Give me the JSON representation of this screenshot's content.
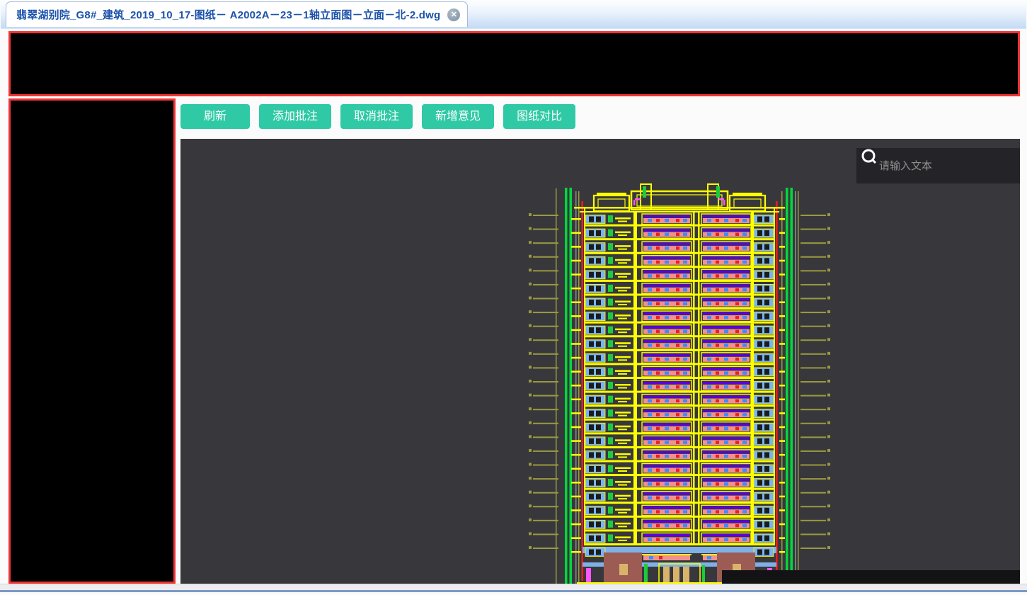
{
  "tab": {
    "title": "翡翠湖别院_G8#_建筑_2019_10_17-图纸－ A2002A－23－1轴立面图－立面－北-2.dwg",
    "close_glyph": "✕"
  },
  "toolbar": {
    "buttons": [
      {
        "label": "刷新"
      },
      {
        "label": "添加批注"
      },
      {
        "label": "取消批注"
      },
      {
        "label": "新增意见"
      },
      {
        "label": "图纸对比"
      }
    ],
    "button_color": "#2fc9a5"
  },
  "search": {
    "placeholder": "请输入文本"
  },
  "panels": {
    "fill": "#000000",
    "border": "#f03434"
  },
  "canvas": {
    "background": "#38383c"
  },
  "drawing": {
    "type": "cad-building-elevation",
    "floors": 24,
    "colors": {
      "outline": "#ffff00",
      "window": "#7ab3f0",
      "pane": "#1c1c1c",
      "band": "#f29090",
      "accent_purple": "#5a00e0",
      "accent_green": "#1ecb3c",
      "accent_magenta": "#ff55ff",
      "mark_blue": "#3a8cff",
      "mark_red": "#e62222",
      "dimension": "#9a9a40",
      "dimension_green": "#00d83c",
      "dimension_gray": "#8a8a8a",
      "edge_red": "#ff1a1a",
      "base_blue": "#7fb0e8",
      "base_brown": "#9c5c54",
      "base_tan": "#d9b36a",
      "label_box": "#131315"
    }
  }
}
